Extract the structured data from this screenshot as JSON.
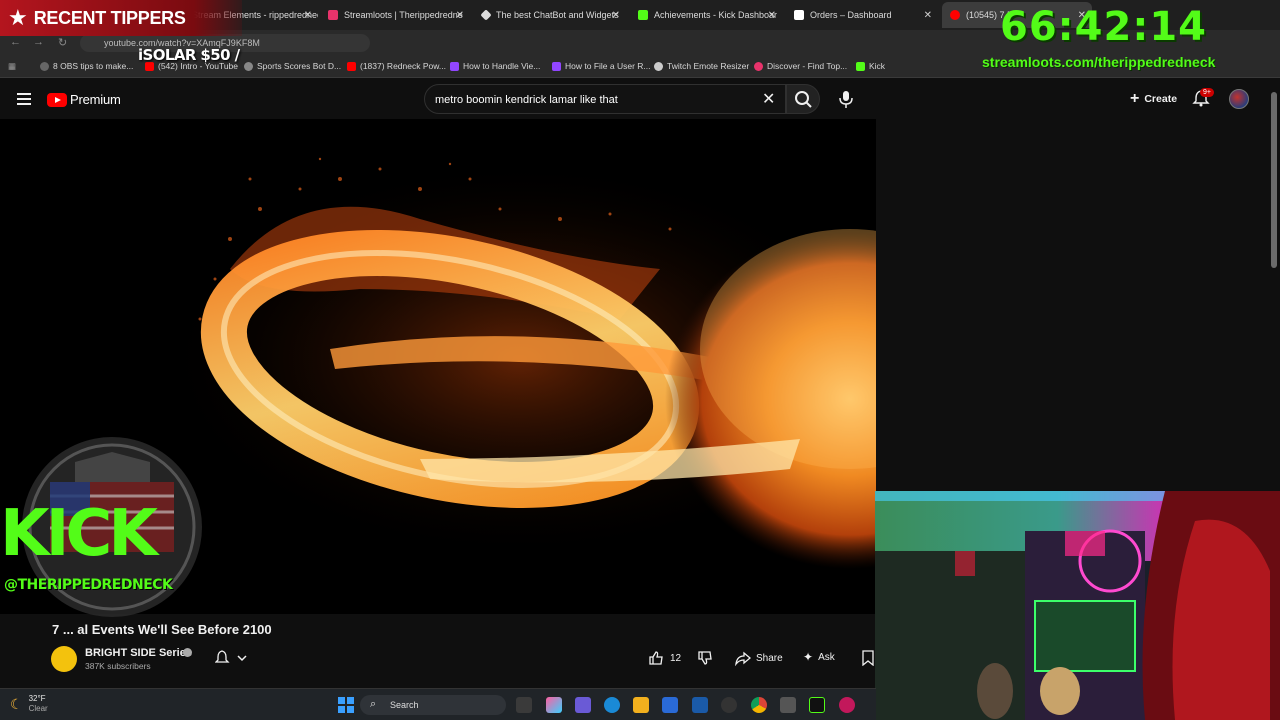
{
  "browser": {
    "tabs": [
      {
        "label": "Stream Elements - rippedredneck",
        "color": "#3a4bd6"
      },
      {
        "label": "Streamloots | Therippedredne",
        "color": "#e8336b"
      },
      {
        "label": "The best ChatBot and Widgets",
        "color": "#dddddd"
      },
      {
        "label": "Achievements - Kick Dashboar",
        "color": "#53fc18"
      },
      {
        "label": "Orders – Dashboard",
        "color": "#ffffff"
      },
      {
        "label": "(10545) 7 R",
        "color": "#ff0000"
      }
    ],
    "url": "youtube.com/watch?v=XAmqFJ9KF8M",
    "bookmarks": [
      "8 OBS tips to make...",
      "(542) Intro - YouTube",
      "Sports Scores Bot D...",
      "(1837) Redneck Pow...",
      "How to Handle Vie...",
      "How to File a User R...",
      "Twitch Emote Resizer",
      "Discover - Find Top...",
      "Kick"
    ]
  },
  "overlay": {
    "tippers_title": "RECENT TIPPERS",
    "ticker": "iSOLAR $50 /",
    "timer": "66:42:14",
    "stream_link": "streamloots.com/therippedredneck",
    "kick_word": "KICK",
    "kick_handle": "@THERIPPEDREDNECK"
  },
  "youtube": {
    "logo_word": "Premium",
    "search_value": "metro boomin kendrick lamar like that",
    "create_label": "Create",
    "notif_badge": "9+",
    "video_title": "7 ... al Events We'll See Before 2100",
    "channel_name": "BRIGHT SIDE Series",
    "subscribers": "387K subscribers",
    "like_count": "12",
    "share_label": "Share",
    "ask_label": "Ask"
  },
  "taskbar": {
    "temp": "32°F",
    "condition": "Clear",
    "search_label": "Search"
  },
  "colors": {
    "kick_green": "#53fc18",
    "yt_red": "#ff0000",
    "tipper_red": "#b4151e"
  }
}
